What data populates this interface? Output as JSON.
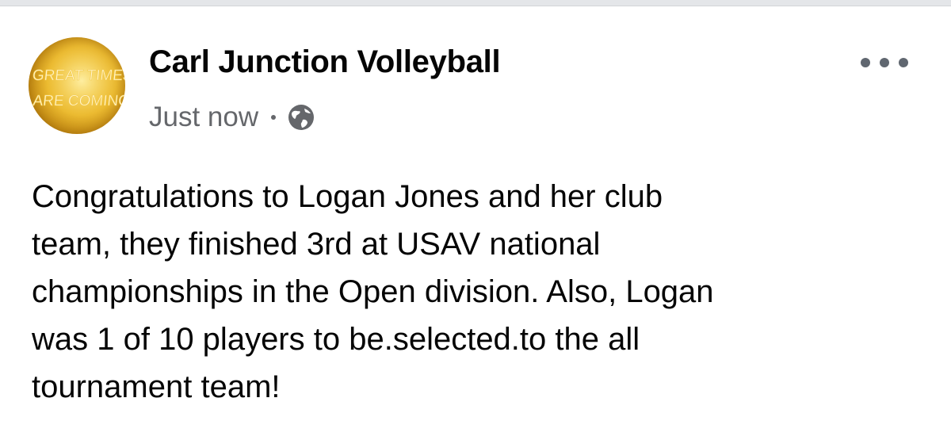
{
  "post": {
    "author": "Carl Junction Volleyball",
    "timestamp": "Just now",
    "separator": "•",
    "privacy_icon": "globe-icon",
    "more_icon": "more-options-icon",
    "avatar": {
      "icon": "great-times-are-coming-avatar",
      "line1": "GREAT TIMES",
      "line2": "ARE COMING"
    },
    "text": "Congratulations to Logan Jones and her club\nteam, they finished 3rd at USAV national\nchampionships in the Open division.   Also, Logan\nwas 1 of 10 players to be.selected.to the all\ntournament team!"
  },
  "colors": {
    "author_text": "#050505",
    "meta_text": "#65676b",
    "avatar_gold": "#e9b52a",
    "background": "#ffffff"
  }
}
